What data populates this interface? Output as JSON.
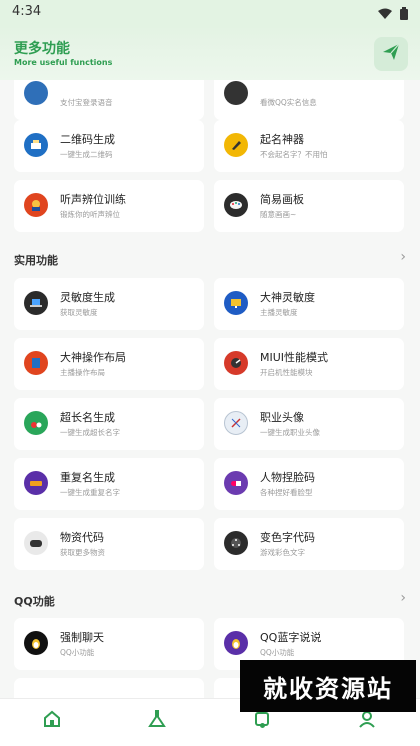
{
  "status": {
    "time": "4:34"
  },
  "header": {
    "title": "更多功能",
    "subtitle": "More useful functions"
  },
  "sections": {
    "practical": {
      "title": "实用功能"
    },
    "qq": {
      "title": "QQ功能"
    }
  },
  "cards": {
    "partial_left": {
      "name": "",
      "desc": "支付宝登录语音"
    },
    "partial_right": {
      "name": "",
      "desc": "看微QQ实名信息"
    },
    "qrcode": {
      "name": "二维码生成",
      "desc": "一键生成二维码"
    },
    "naming": {
      "name": "起名神器",
      "desc": "不会起名字？不用怕"
    },
    "listen": {
      "name": "听声辨位训练",
      "desc": "锻炼你的听声辨位"
    },
    "sketch": {
      "name": "简易画板",
      "desc": "随意画画~"
    },
    "sensitivity": {
      "name": "灵敏度生成",
      "desc": "获取灵敏度"
    },
    "god_sensitivity": {
      "name": "大神灵敏度",
      "desc": "主播灵敏度"
    },
    "god_layout": {
      "name": "大神操作布局",
      "desc": "主播操作布局"
    },
    "miui": {
      "name": "MIUI性能模式",
      "desc": "开启机性能模块"
    },
    "long_name": {
      "name": "超长名生成",
      "desc": "一键生成超长名字"
    },
    "profession": {
      "name": "职业头像",
      "desc": "一键生成职业头像"
    },
    "dup_name": {
      "name": "重复名生成",
      "desc": "一键生成重复名字"
    },
    "pinch_face": {
      "name": "人物捏脸码",
      "desc": "各种捏好看脸型"
    },
    "item_code": {
      "name": "物资代码",
      "desc": "获取更多物资"
    },
    "color_code": {
      "name": "变色字代码",
      "desc": "游戏彩色文字"
    },
    "force_chat": {
      "name": "强制聊天",
      "desc": "QQ小功能"
    },
    "qq_blue": {
      "name": "QQ蓝字说说",
      "desc": "QQ小功能"
    }
  },
  "watermark": {
    "text": "就收资源站"
  },
  "colors": {
    "accent": "#2f9e52",
    "header_bg": "#e3f3e3",
    "card_bg": "#ffffff",
    "page_bg": "#f6f7f6"
  },
  "icons": {
    "status": [
      "wifi-icon",
      "battery-icon"
    ],
    "header": "send-icon",
    "nav": [
      "home-icon",
      "flask-icon",
      "tools-icon",
      "profile-icon"
    ]
  }
}
